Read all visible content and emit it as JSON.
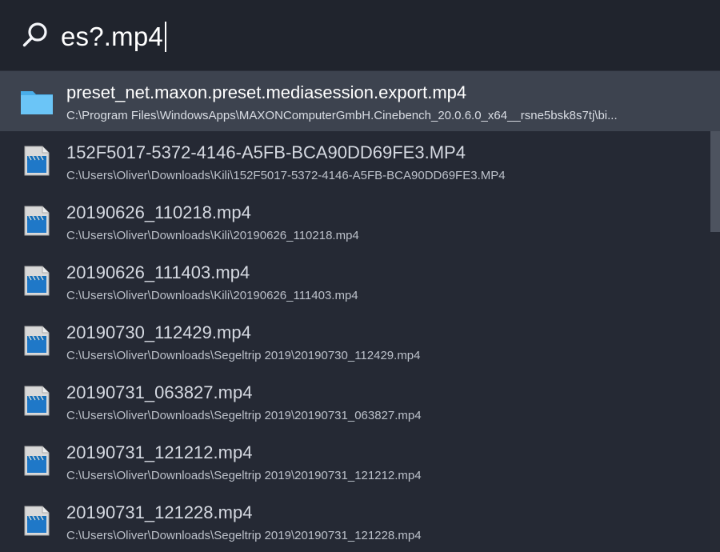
{
  "search": {
    "query": "es?.mp4",
    "icon": "search-icon"
  },
  "results": [
    {
      "title": "preset_net.maxon.preset.mediasession.export.mp4",
      "path": "C:\\Program Files\\WindowsApps\\MAXONComputerGmbH.Cinebench_20.0.6.0_x64__rsne5bsk8s7tj\\bi...",
      "icon": "folder-icon",
      "selected": true
    },
    {
      "title": "152F5017-5372-4146-A5FB-BCA90DD69FE3.MP4",
      "path": "C:\\Users\\Oliver\\Downloads\\Kili\\152F5017-5372-4146-A5FB-BCA90DD69FE3.MP4",
      "icon": "video-file-icon"
    },
    {
      "title": "20190626_110218.mp4",
      "path": "C:\\Users\\Oliver\\Downloads\\Kili\\20190626_110218.mp4",
      "icon": "video-file-icon"
    },
    {
      "title": "20190626_111403.mp4",
      "path": "C:\\Users\\Oliver\\Downloads\\Kili\\20190626_111403.mp4",
      "icon": "video-file-icon"
    },
    {
      "title": "20190730_112429.mp4",
      "path": "C:\\Users\\Oliver\\Downloads\\Segeltrip 2019\\20190730_112429.mp4",
      "icon": "video-file-icon"
    },
    {
      "title": "20190731_063827.mp4",
      "path": "C:\\Users\\Oliver\\Downloads\\Segeltrip 2019\\20190731_063827.mp4",
      "icon": "video-file-icon"
    },
    {
      "title": "20190731_121212.mp4",
      "path": "C:\\Users\\Oliver\\Downloads\\Segeltrip 2019\\20190731_121212.mp4",
      "icon": "video-file-icon"
    },
    {
      "title": "20190731_121228.mp4",
      "path": "C:\\Users\\Oliver\\Downloads\\Segeltrip 2019\\20190731_121228.mp4",
      "icon": "video-file-icon"
    }
  ],
  "colors": {
    "background": "#252934",
    "search_background": "#20242d",
    "selected_background": "#3d434f",
    "folder": "#55b7f1",
    "video_icon": "#1f78c8"
  }
}
